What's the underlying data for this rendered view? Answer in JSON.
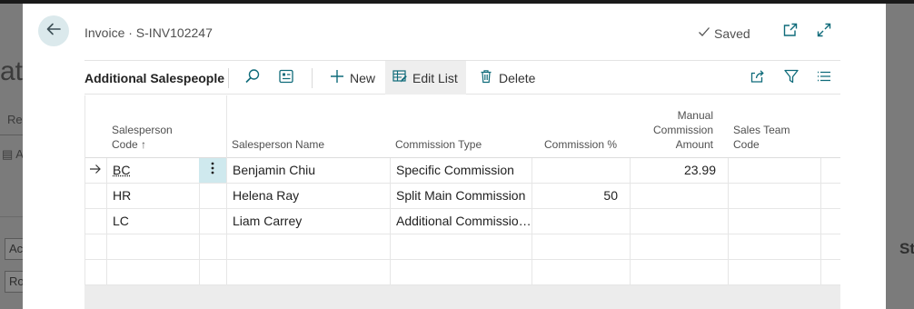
{
  "background": {
    "partial_title": "at",
    "left_label_1": "Re",
    "left_label_2": "A",
    "field_1": "Ac",
    "field_2": "Ro",
    "right_text": "St"
  },
  "header": {
    "title": "Invoice · S-INV102247",
    "saved_label": "Saved",
    "icons": [
      "back-arrow",
      "open-in-new-window",
      "expand"
    ]
  },
  "actionbar": {
    "part_title": "Additional Salespeople",
    "new_label": "New",
    "edit_list_label": "Edit List",
    "delete_label": "Delete"
  },
  "grid": {
    "columns": {
      "code": [
        "Salesperson",
        "Code ↑"
      ],
      "name": "Salesperson Name",
      "commission_type": "Commission Type",
      "commission_pct": "Commission %",
      "manual_amount": [
        "Manual",
        "Commission",
        "Amount"
      ],
      "sales_team": [
        "Sales Team",
        "Code"
      ]
    },
    "rows": [
      {
        "code": "BC",
        "name": "Benjamin Chiu",
        "commission_type": "Specific Commission",
        "commission_pct": "",
        "manual_amount": "23.99",
        "sales_team": ""
      },
      {
        "code": "HR",
        "name": "Helena Ray",
        "commission_type": "Split Main Commission",
        "commission_pct": "50",
        "manual_amount": "",
        "sales_team": ""
      },
      {
        "code": "LC",
        "name": "Liam Carrey",
        "commission_type": "Additional Commissio…",
        "commission_pct": "",
        "manual_amount": "",
        "sales_team": ""
      },
      {
        "code": "",
        "name": "",
        "commission_type": "",
        "commission_pct": "",
        "manual_amount": "",
        "sales_team": ""
      },
      {
        "code": "",
        "name": "",
        "commission_type": "",
        "commission_pct": "",
        "manual_amount": "",
        "sales_team": ""
      }
    ]
  },
  "colors": {
    "accent": "#0f6b7a",
    "selected_cell": "#cfe9ee",
    "back_button": "#dbe9ec"
  }
}
